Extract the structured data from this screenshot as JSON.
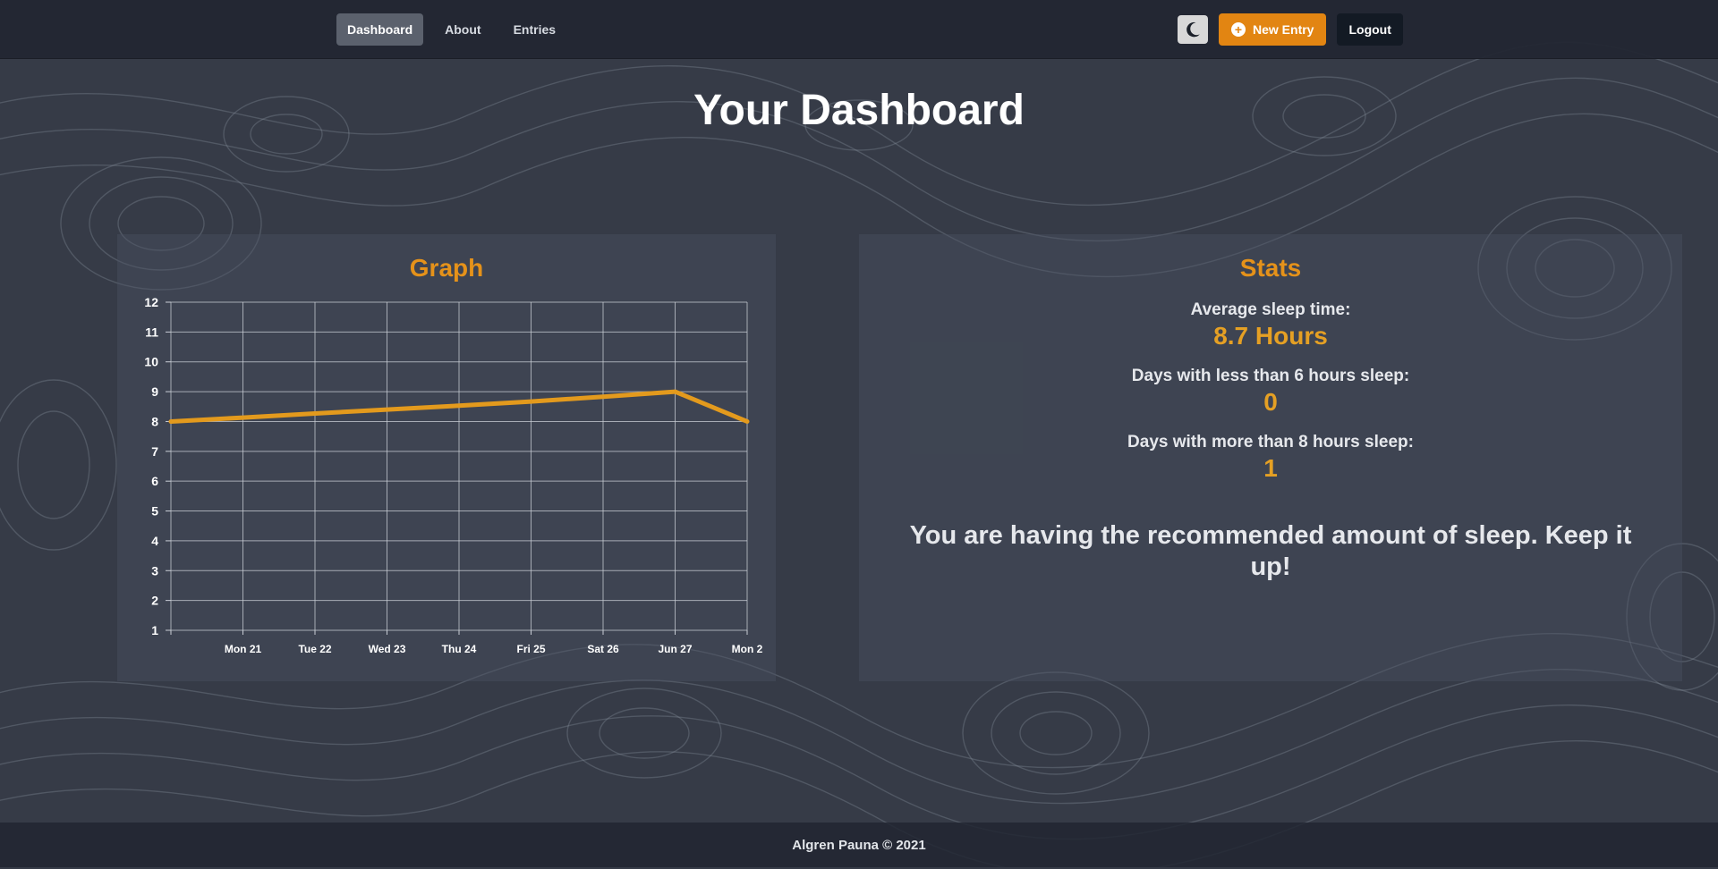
{
  "nav": {
    "links": [
      {
        "label": "Dashboard",
        "active": true
      },
      {
        "label": "About",
        "active": false
      },
      {
        "label": "Entries",
        "active": false
      }
    ],
    "theme_toggle_icon": "moon-icon",
    "new_entry_label": "New Entry",
    "new_entry_icon": "plus-circle-icon",
    "logout_label": "Logout"
  },
  "page_title": "Your Dashboard",
  "graph": {
    "title": "Graph"
  },
  "stats": {
    "title": "Stats",
    "items": [
      {
        "label": "Average sleep time:",
        "value": "8.7 Hours"
      },
      {
        "label": "Days with less than 6 hours sleep:",
        "value": "0"
      },
      {
        "label": "Days with more than 8 hours sleep:",
        "value": "1"
      }
    ],
    "message": "You are having the recommended amount of sleep. Keep it up!"
  },
  "footer": {
    "text": "Algren Pauna © 2021"
  },
  "colors": {
    "accent": "#e5921a",
    "line": "#e39a1d",
    "background": "#363b47",
    "navbar": "#212631"
  },
  "chart_data": {
    "type": "line",
    "x": [
      "",
      "Mon 21",
      "Tue 22",
      "Wed 23",
      "Thu 24",
      "Fri 25",
      "Sat 26",
      "Jun 27",
      "Mon 2"
    ],
    "series": [
      {
        "values": [
          8,
          8.13,
          8.27,
          8.4,
          8.53,
          8.67,
          8.83,
          9,
          8
        ]
      }
    ],
    "y_ticks": [
      "1",
      "2",
      "3",
      "4",
      "5",
      "6",
      "7",
      "8",
      "9",
      "10",
      "11",
      "12"
    ],
    "ylim": [
      1,
      12
    ],
    "grid": true
  }
}
